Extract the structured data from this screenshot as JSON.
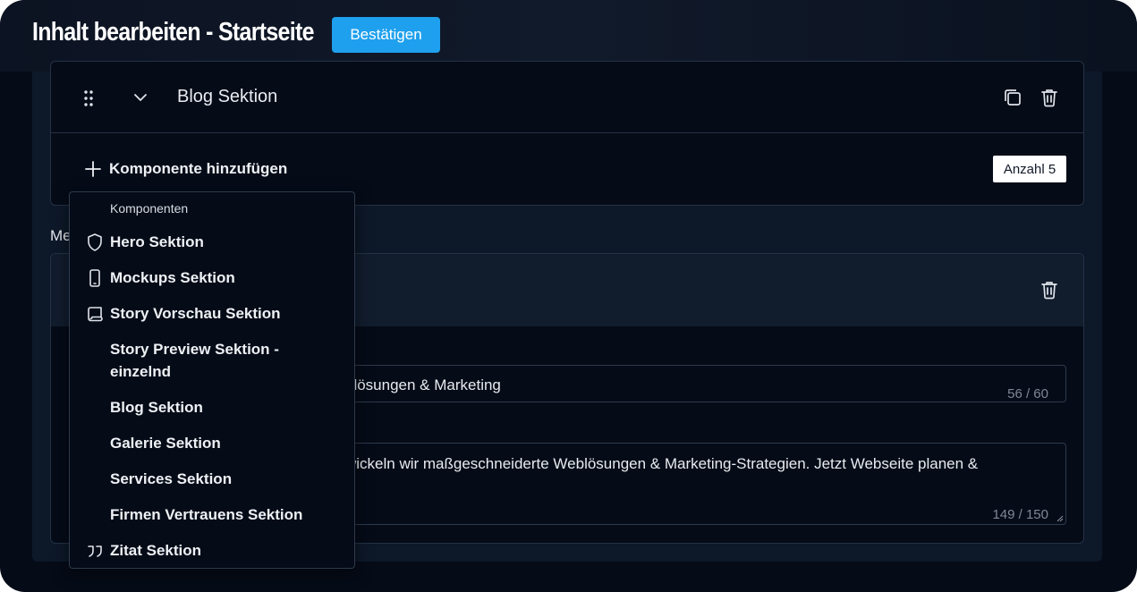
{
  "header": {
    "title": "Inhalt bearbeiten - Startseite",
    "confirm_label": "Bestätigen"
  },
  "blog_section": {
    "title": "Blog Sektion",
    "add_component_label": "Komponente hinzufügen",
    "count_label": "Anzahl 5"
  },
  "meta_section": {
    "label_visible": "Me",
    "field1_value": "blösungen & Marketing",
    "field1_counter": "56 / 60",
    "field2_value": "wickeln wir maßgeschneiderte Weblösungen & Marketing-Strategien. Jetzt Webseite planen &",
    "field2_counter": "149 / 150"
  },
  "dropdown": {
    "heading": "Komponenten",
    "items": [
      {
        "label": "Hero Sektion",
        "icon": "shield-icon"
      },
      {
        "label": "Mockups Sektion",
        "icon": "smartphone-icon"
      },
      {
        "label": "Story Vorschau Sektion",
        "icon": "scroll-icon"
      },
      {
        "label": "Story Preview Sektion - einzelnd",
        "icon": ""
      },
      {
        "label": "Blog Sektion",
        "icon": ""
      },
      {
        "label": "Galerie Sektion",
        "icon": ""
      },
      {
        "label": "Services Sektion",
        "icon": ""
      },
      {
        "label": "Firmen Vertrauens Sektion",
        "icon": ""
      },
      {
        "label": "Zitat Sektion",
        "icon": "quote-icon"
      }
    ]
  },
  "colors": {
    "background": "#050b17",
    "panel": "#0d1829",
    "accent": "#1fa0ee",
    "border": "#253246"
  }
}
